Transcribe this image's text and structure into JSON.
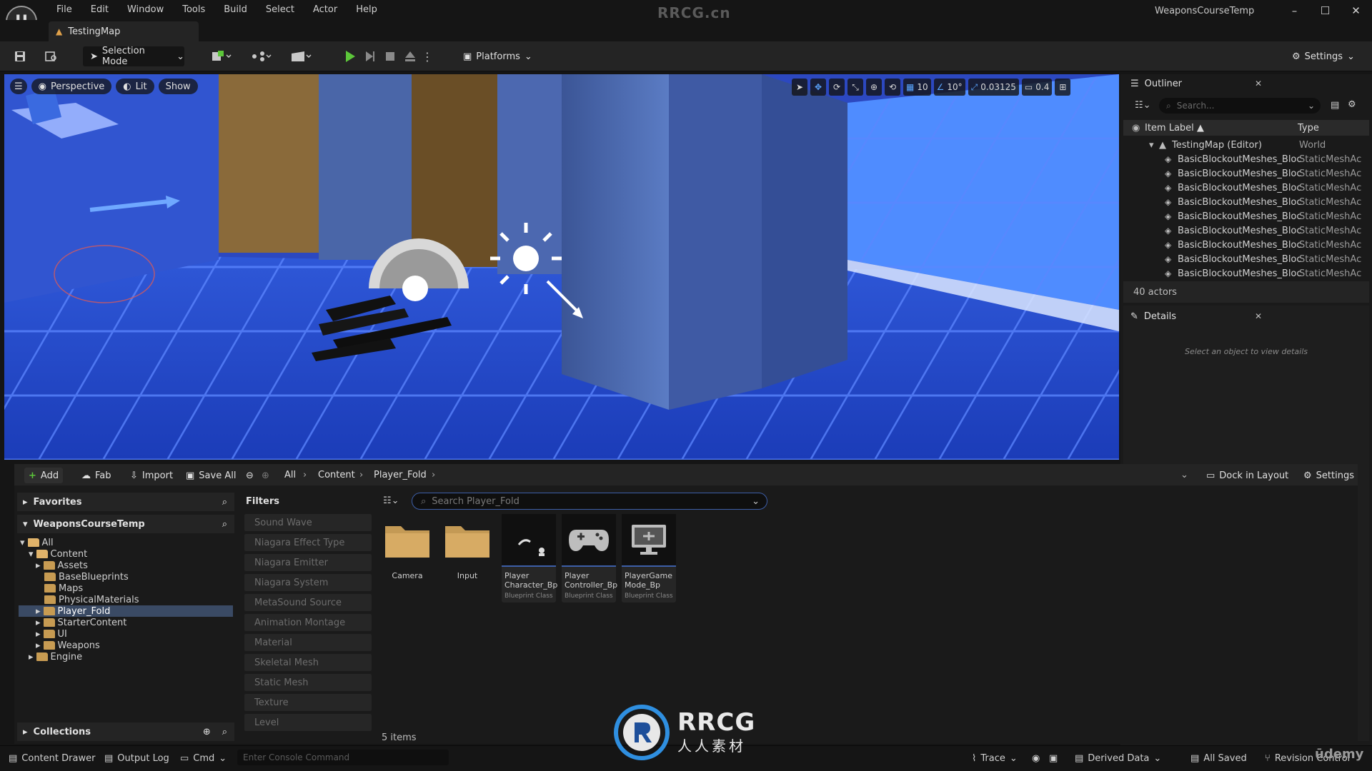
{
  "app": {
    "logo_text": "U",
    "watermark": "RRCG.cn",
    "project_name": "WeaponsCourseTemp",
    "window_buttons": [
      "–",
      "☐",
      "✕"
    ]
  },
  "menu": [
    "File",
    "Edit",
    "Window",
    "Tools",
    "Build",
    "Select",
    "Actor",
    "Help"
  ],
  "map_tab": {
    "label": "TestingMap"
  },
  "toolbar": {
    "selection_mode": "Selection Mode",
    "platforms": "Platforms",
    "settings": "Settings"
  },
  "viewport": {
    "perspective": "Perspective",
    "lit": "Lit",
    "show": "Show",
    "grid_snap": "10",
    "rotation_snap": "10°",
    "scale_snap": "0.03125",
    "camera_speed": "0.4"
  },
  "outliner": {
    "title": "Outliner",
    "search_placeholder": "Search...",
    "col_label": "Item Label ▲",
    "col_type": "Type",
    "root": {
      "label": "TestingMap (Editor)",
      "type": "World"
    },
    "rows": [
      {
        "label": "BasicBlockoutMeshes_Bloc",
        "type": "StaticMeshAc"
      },
      {
        "label": "BasicBlockoutMeshes_Bloc",
        "type": "StaticMeshAc"
      },
      {
        "label": "BasicBlockoutMeshes_Bloc",
        "type": "StaticMeshAc"
      },
      {
        "label": "BasicBlockoutMeshes_Bloc",
        "type": "StaticMeshAc"
      },
      {
        "label": "BasicBlockoutMeshes_Bloc",
        "type": "StaticMeshAc"
      },
      {
        "label": "BasicBlockoutMeshes_Bloc",
        "type": "StaticMeshAc"
      },
      {
        "label": "BasicBlockoutMeshes_Bloc",
        "type": "StaticMeshAc"
      },
      {
        "label": "BasicBlockoutMeshes_Bloc",
        "type": "StaticMeshAc"
      },
      {
        "label": "BasicBlockoutMeshes_Bloc",
        "type": "StaticMeshAc"
      }
    ],
    "count": "40 actors"
  },
  "details": {
    "title": "Details",
    "hint": "Select an object to view details"
  },
  "content_browser": {
    "add": "Add",
    "fab": "Fab",
    "import": "Import",
    "save_all": "Save All",
    "crumbs": [
      "All",
      "Content",
      "Player_Fold"
    ],
    "dock_in_layout": "Dock in Layout",
    "settings": "Settings",
    "favorites": "Favorites",
    "project": "WeaponsCourseTemp",
    "collections": "Collections",
    "tree": {
      "all": "All",
      "content": "Content",
      "assets": "Assets",
      "base_blueprints": "BaseBlueprints",
      "maps": "Maps",
      "physical_materials": "PhysicalMaterials",
      "player_fold": "Player_Fold",
      "starter_content": "StarterContent",
      "ui": "UI",
      "weapons": "Weapons",
      "engine": "Engine"
    },
    "filters_title": "Filters",
    "filters": [
      "Sound Wave",
      "Niagara Effect Type",
      "Niagara Emitter",
      "Niagara System",
      "MetaSound Source",
      "Animation Montage",
      "Material",
      "Skeletal Mesh",
      "Static Mesh",
      "Texture",
      "Level"
    ],
    "search_placeholder": "Search Player_Fold",
    "assets": [
      {
        "name": "Camera"
      },
      {
        "name": "Input"
      },
      {
        "name": "Player Character_Bp",
        "kind": "Blueprint Class"
      },
      {
        "name": "Player Controller_Bp",
        "kind": "Blueprint Class"
      },
      {
        "name": "PlayerGame Mode_Bp",
        "kind": "Blueprint Class"
      }
    ],
    "items_count": "5 items"
  },
  "statusbar": {
    "content_drawer": "Content Drawer",
    "output_log": "Output Log",
    "cmd": "Cmd",
    "console_placeholder": "Enter Console Command",
    "trace": "Trace",
    "derived_data": "Derived Data",
    "all_saved": "All Saved",
    "revision_control": "Revision Control"
  },
  "overlay": {
    "logo_text": "RRCG",
    "logo_sub": "人人素材",
    "udemy": "ūdemy"
  },
  "colors": {
    "accent_blue": "#3c5fa8",
    "play_green": "#5cc63a",
    "folder": "#c79b52"
  }
}
